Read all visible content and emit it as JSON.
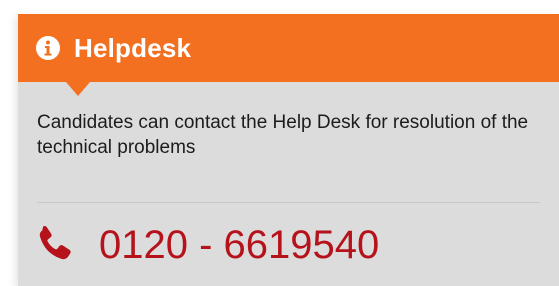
{
  "helpdesk": {
    "title": "Helpdesk",
    "description": "Candidates can contact the Help Desk for resolution of the technical problems",
    "phone": "0120 - 6619540"
  },
  "icons": {
    "header": "info-icon",
    "phone": "phone-icon"
  },
  "colors": {
    "header_bg": "#f37021",
    "card_bg": "#dcdcdc",
    "phone_color": "#b5121b",
    "title_color": "#ffffff"
  }
}
